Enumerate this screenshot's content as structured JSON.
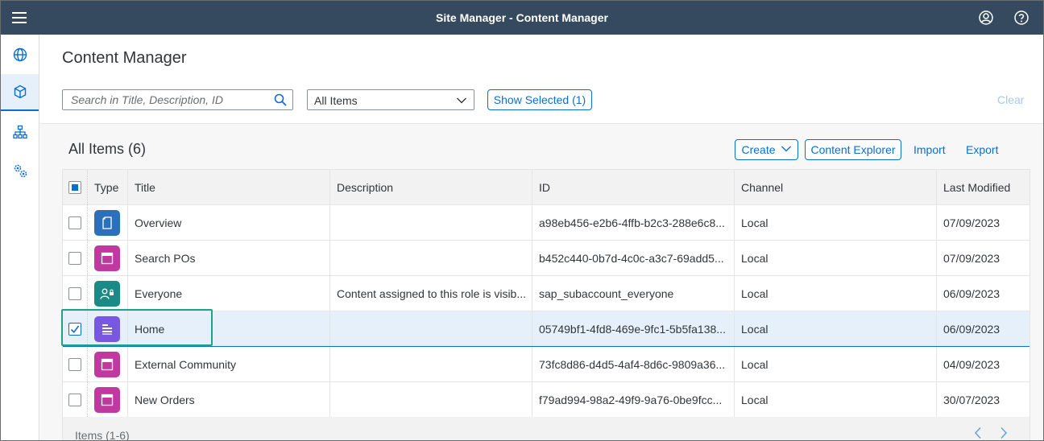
{
  "shell": {
    "title": "Site Manager - Content Manager",
    "icons": [
      "menu-icon",
      "user-icon",
      "help-icon"
    ]
  },
  "sidenav": {
    "items": [
      {
        "name": "globe-icon",
        "selected": false
      },
      {
        "name": "cube-icon",
        "selected": true
      },
      {
        "name": "hierarchy-icon",
        "selected": false
      },
      {
        "name": "settings-icon",
        "selected": false
      }
    ]
  },
  "page": {
    "title": "Content Manager",
    "search_placeholder": "Search in Title, Description, ID",
    "filter_value": "All Items",
    "show_selected": "Show Selected (1)",
    "clear": "Clear"
  },
  "table": {
    "heading": "All Items (6)",
    "actions": {
      "create": "Create",
      "explorer": "Content Explorer",
      "import": "Import",
      "export": "Export"
    },
    "columns": {
      "type": "Type",
      "title": "Title",
      "description": "Description",
      "id": "ID",
      "channel": "Channel",
      "modified": "Last Modified"
    },
    "rows": [
      {
        "icon": "page-icon",
        "icon_color": "#2b70bd",
        "title": "Overview",
        "description": "",
        "id": "a98eb456-e2b6-4ffb-b2c3-288e6c8...",
        "channel": "Local",
        "modified": "07/09/2023",
        "checked": false
      },
      {
        "icon": "app-icon",
        "icon_color": "#c0399f",
        "title": "Search POs",
        "description": "",
        "id": "b452c440-0b7d-4c0c-a3c7-69add5...",
        "channel": "Local",
        "modified": "07/09/2023",
        "checked": false
      },
      {
        "icon": "role-icon",
        "icon_color": "#1a8a86",
        "title": "Everyone",
        "description": "Content assigned to this role is visib...",
        "id": "sap_subaccount_everyone",
        "channel": "Local",
        "modified": "06/09/2023",
        "checked": false
      },
      {
        "icon": "space-icon",
        "icon_color": "#7858e0",
        "title": "Home",
        "description": "",
        "id": "05749bf1-4fd8-469e-9fc1-5b5fa138...",
        "channel": "Local",
        "modified": "06/09/2023",
        "checked": true
      },
      {
        "icon": "app-icon",
        "icon_color": "#c0399f",
        "title": "External Community",
        "description": "",
        "id": "73fc8d86-d4d5-4af4-8d6c-9809a36...",
        "channel": "Local",
        "modified": "04/09/2023",
        "checked": false
      },
      {
        "icon": "app-icon",
        "icon_color": "#c0399f",
        "title": "New Orders",
        "description": "",
        "id": "f79ad994-98a2-49f9-9a76-0be9fcc...",
        "channel": "Local",
        "modified": "30/07/2023",
        "checked": false
      }
    ],
    "footer": "Items (1-6)"
  }
}
